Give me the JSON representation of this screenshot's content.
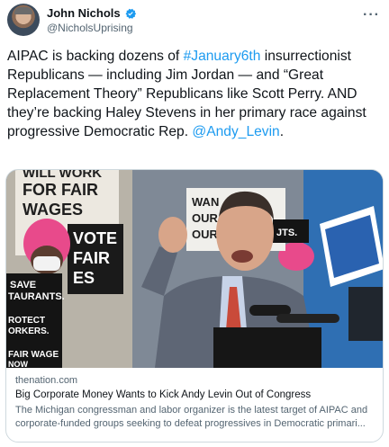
{
  "author": {
    "display_name": "John Nichols",
    "handle": "@NicholsUprising"
  },
  "tweet": {
    "text_1": "AIPAC is backing dozens of ",
    "hashtag": "#January6th",
    "text_2": " insurrectionist Republicans — including Jim Jordan — and “Great Replacement Theory” Republicans like Scott Perry. AND they’re backing Haley Stevens in her primary race against progressive Democratic Rep. ",
    "mention": "@Andy_Levin",
    "text_3": "."
  },
  "photo_signs": {
    "sign_1_l1": "WILL WORK",
    "sign_1_l2": "FOR FAIR",
    "sign_1_l3": "WAGES",
    "sign_2_l1": "VOTE",
    "sign_2_l2": "FAIR",
    "sign_2_l3": "ES",
    "sign_3_l1": "SAVE",
    "sign_3_l2": "TAURANTS.",
    "sign_4_l1": "ROTECT",
    "sign_4_l2": "ORKERS.",
    "sign_5_l1": "FAIR WAGE",
    "sign_5_l2": "NOW",
    "sign_6_l1": "WAN",
    "sign_6_l2": "OUR",
    "sign_6_l3": "OUR",
    "sign_7_l1": "JTS."
  },
  "card": {
    "domain": "thenation.com",
    "title": "Big Corporate Money Wants to Kick Andy Levin Out of Congress",
    "description": "The Michigan congressman and labor organizer is the latest target of AIPAC and corporate-funded groups seeking to defeat progressives in Democratic primari..."
  },
  "icons": {
    "verified": "verified-badge-icon",
    "more": "more-options-icon"
  },
  "colors": {
    "link": "#1d9bf0",
    "verified": "#1d9bf0",
    "secondary_text": "#536471"
  }
}
